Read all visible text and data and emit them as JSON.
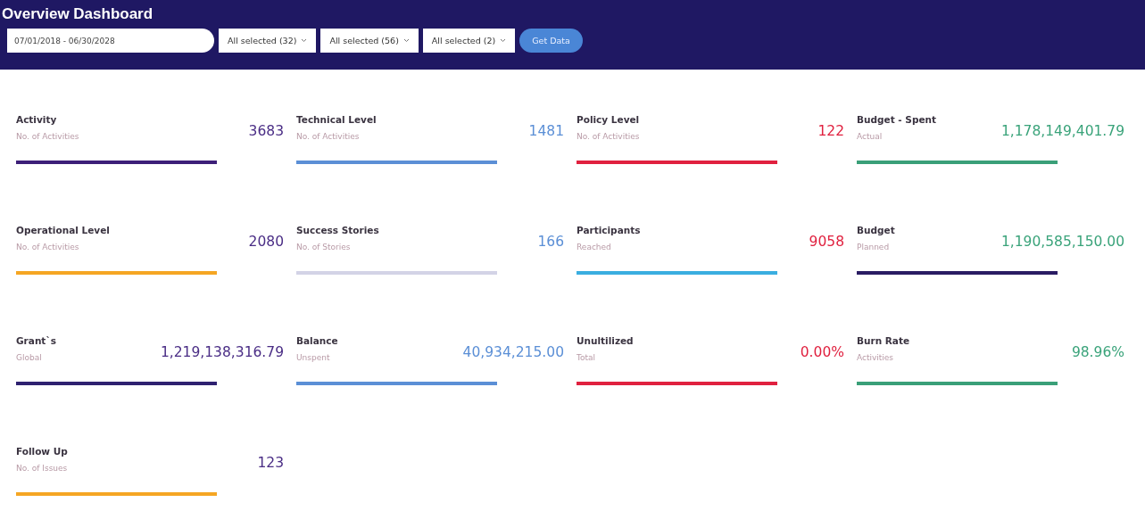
{
  "header": {
    "title": "Overview Dashboard",
    "date_range": "07/01/2018 - 06/30/2028",
    "dropdowns": [
      "All selected (32)",
      "All selected (56)",
      "All selected (2)"
    ],
    "button": "Get Data"
  },
  "cards": [
    {
      "title": "Activity",
      "subtitle": "No. of Activities",
      "value": {
        "text": "3683",
        "color": "#4a2d85"
      },
      "bar": {
        "color": "#3d1f78"
      }
    },
    {
      "title": "Technical Level",
      "subtitle": "No. of Activities",
      "value": {
        "text": "1481",
        "color": "#5b8fd6"
      },
      "bar": {
        "color": "#5b8fd6"
      }
    },
    {
      "title": "Policy Level",
      "subtitle": "No. of Activities",
      "value": {
        "text": "122",
        "color": "#e0213f"
      },
      "bar": {
        "color": "#e0213f"
      }
    },
    {
      "title": "Budget - Spent",
      "subtitle": "Actual",
      "value": {
        "text": "1,178,149,401.79",
        "color": "#3aa37a"
      },
      "bar": {
        "color": "#3a9f78"
      }
    },
    {
      "title": "Operational Level",
      "subtitle": "No. of Activities",
      "value": {
        "text": "2080",
        "color": "#4a2d85"
      },
      "bar": {
        "color": "#f5a623"
      }
    },
    {
      "title": "Success Stories",
      "subtitle": "No. of Stories",
      "value": {
        "text": "166",
        "color": "#5b8fd6"
      },
      "bar": {
        "color": "#d3d3e6"
      }
    },
    {
      "title": "Participants",
      "subtitle": "Reached",
      "value": {
        "text": "9058",
        "color": "#e0213f"
      },
      "bar": {
        "color": "#3aaee0"
      }
    },
    {
      "title": "Budget",
      "subtitle": "Planned",
      "value": {
        "text": "1,190,585,150.00",
        "color": "#3aa37a"
      },
      "bar": {
        "color": "#2a1c63"
      }
    },
    {
      "title": "Grant`s",
      "subtitle": "Global",
      "value": {
        "text": "1,219,138,316.79",
        "color": "#4a2d85"
      },
      "bar": {
        "color": "#2e2170"
      }
    },
    {
      "title": "Balance",
      "subtitle": "Unspent",
      "value": {
        "text": "40,934,215.00",
        "color": "#5b8fd6"
      },
      "bar": {
        "color": "#5b8fd6"
      }
    },
    {
      "title": "Unultilized",
      "subtitle": "Total",
      "value": {
        "text": "0.00%",
        "color": "#e0213f"
      },
      "bar": {
        "color": "#e0213f"
      }
    },
    {
      "title": "Burn Rate",
      "subtitle": "Activities",
      "value": {
        "text": "98.96%",
        "color": "#3aa37a"
      },
      "bar": {
        "color": "#3a9f78"
      }
    },
    {
      "title": "Follow Up",
      "subtitle": "No. of Issues",
      "value": {
        "text": "123",
        "color": "#4a2d85"
      },
      "bar": {
        "color": "#f5a623"
      }
    }
  ]
}
